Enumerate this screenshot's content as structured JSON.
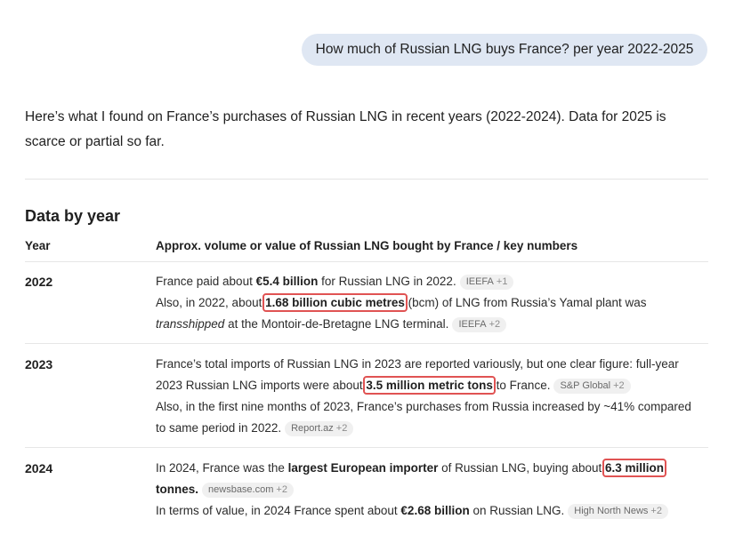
{
  "user_message": "How much of Russian LNG buys France? per year 2022-2025",
  "intro": {
    "line1": "Here’s what I found on France’s purchases of Russian LNG in recent years (2022-2024). Data for 2025 is",
    "line2": "scarce or partial so far."
  },
  "section_title": "Data by year",
  "table": {
    "headers": {
      "year": "Year",
      "description": "Approx. volume or value of Russian LNG bought by France / key numbers"
    },
    "rows": [
      {
        "year": "2022",
        "l1_a": "France paid about ",
        "l1_b": "€5.4 billion",
        "l1_c": " for Russian LNG in 2022.",
        "cite1_src": "IEEFA",
        "cite1_more": "+1",
        "l2_a": "Also, in 2022, about ",
        "l2_hl": "1.68 billion cubic metres",
        "l2_c": " (bcm) of LNG from Russia’s Yamal plant was",
        "l3_i": "transshipped",
        "l3_c": " at the Montoir-de-Bretagne LNG terminal.",
        "cite2_src": "IEEFA",
        "cite2_more": "+2"
      },
      {
        "year": "2023",
        "l1": "France’s total imports of Russian LNG in 2023 are reported variously, but one clear figure: full-year",
        "l2_a": "2023 Russian LNG imports were about ",
        "l2_hl": "3.5 million metric tons",
        "l2_c": " to France.",
        "cite1_src": "S&P Global",
        "cite1_more": "+2",
        "l3": "Also, in the first nine months of 2023, France’s purchases from Russia increased by ~41% compared",
        "l4": "to same period in 2022.",
        "cite2_src": "Report.az",
        "cite2_more": "+2"
      },
      {
        "year": "2024",
        "l1_a": "In 2024, France was the ",
        "l1_b": "largest European importer",
        "l1_c": " of Russian LNG, buying about ",
        "l1_hl": "6.3 million",
        "l2_b": "tonnes.",
        "cite1_src": "newsbase.com",
        "cite1_more": "+2",
        "l3_a": "In terms of value, in 2024 France spent about ",
        "l3_b": "€2.68 billion",
        "l3_c": " on Russian LNG.",
        "cite2_src": "High North News",
        "cite2_more": "+2"
      }
    ]
  }
}
